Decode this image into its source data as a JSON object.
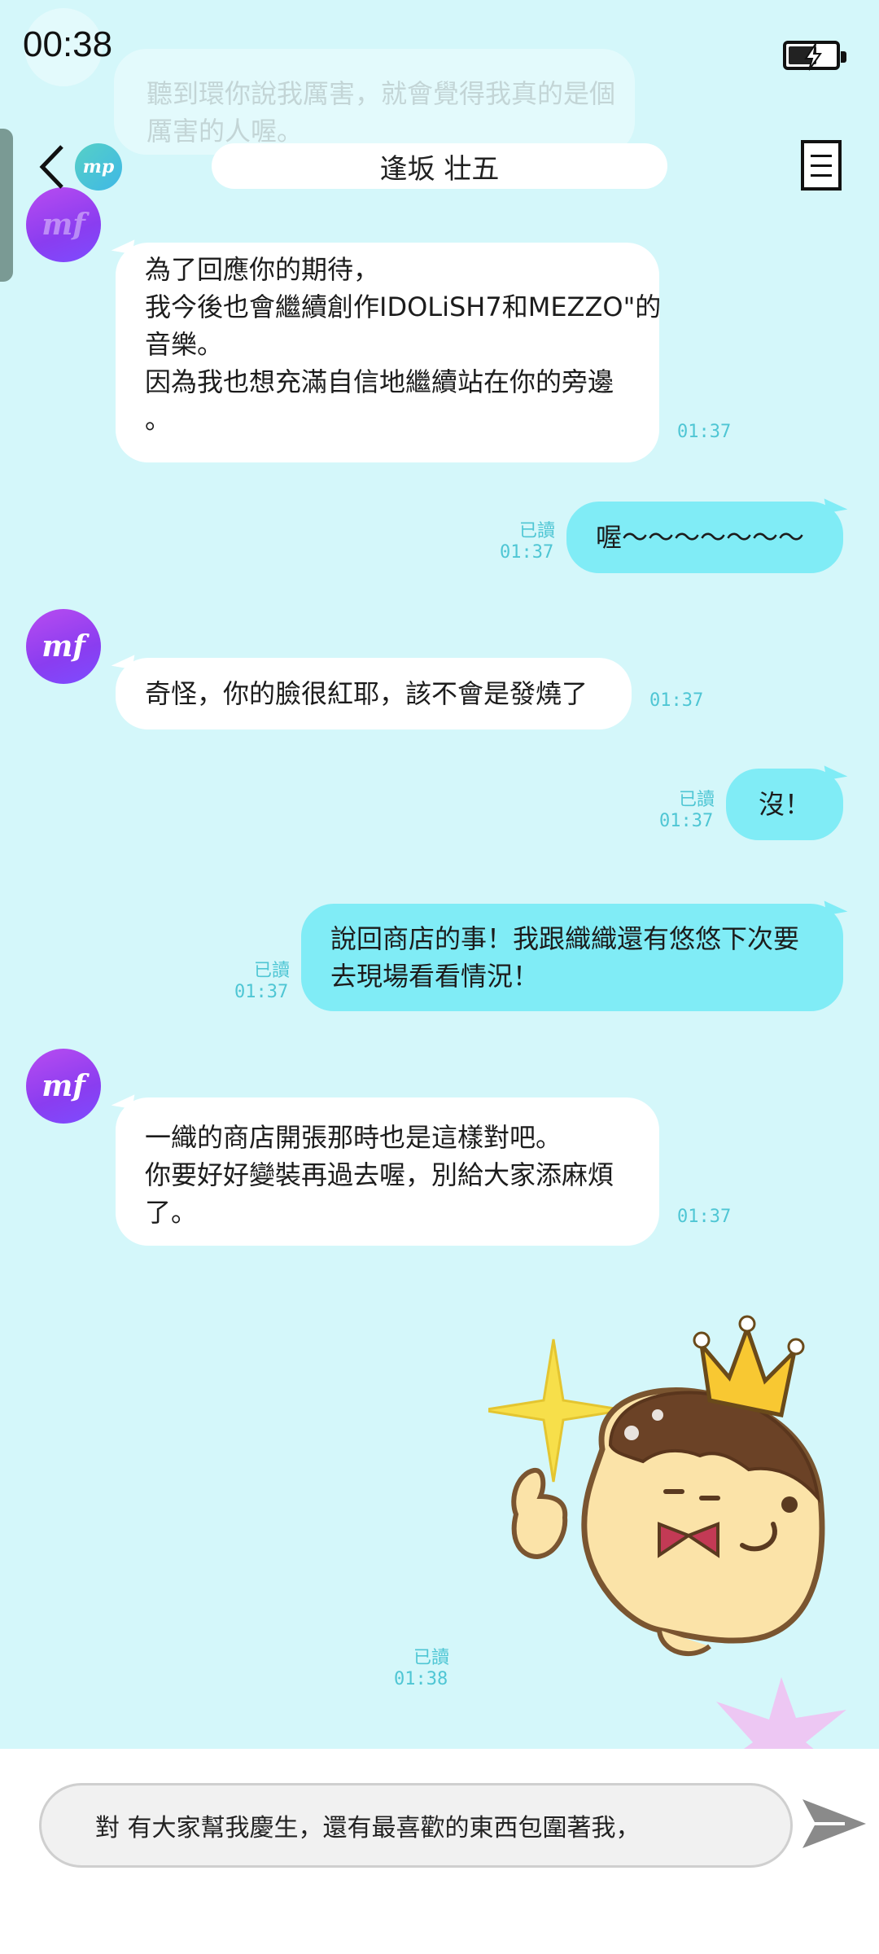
{
  "status_bar": {
    "time": "00:38"
  },
  "faded_message": {
    "lines": [
      "聽到環你說我厲害，就會覺得我真的是個",
      "厲害的人喔。"
    ]
  },
  "header": {
    "avatar_label": "mp",
    "title": "逢坂 壮五"
  },
  "messages": [
    {
      "sender": "mf",
      "direction": "in",
      "lines": [
        "為了回應你的期待，",
        "我今後也會繼續創作IDOLiSH7和MEZZO\"的",
        "音樂。",
        "因為我也想充滿自信地繼續站在你的旁邊",
        "。"
      ],
      "time": "01:37"
    },
    {
      "direction": "out",
      "text": "喔～～～～～～～",
      "read": "已讀",
      "time": "01:37"
    },
    {
      "sender": "mf",
      "direction": "in",
      "text": "奇怪，你的臉很紅耶，該不會是發燒了",
      "time": "01:37"
    },
    {
      "direction": "out",
      "text": "沒！",
      "read": "已讀",
      "time": "01:37"
    },
    {
      "direction": "out",
      "lines": [
        "說回商店的事！我跟織織還有悠悠下次要",
        "去現場看看情況！"
      ],
      "read": "已讀",
      "time": "01:37"
    },
    {
      "sender": "mf",
      "direction": "in",
      "lines": [
        "一織的商店開張那時也是這樣對吧。",
        "你要好好變裝再過去喔，別給大家添麻煩",
        "了。"
      ],
      "time": "01:37"
    },
    {
      "direction": "out",
      "type": "sticker",
      "sticker": "crowned-mascot-thumbs-up",
      "read": "已讀",
      "time": "01:38"
    }
  ],
  "avatar_label_mf": "mf",
  "input": {
    "value": "對  有大家幫我慶生，還有最喜歡的東西包圍著我，"
  },
  "colors": {
    "background": "#d4f7fa",
    "outgoing_bubble": "#80ecf6",
    "incoming_bubble": "#ffffff",
    "timestamp": "#4fc6d4",
    "avatar": "#9b45f0"
  }
}
